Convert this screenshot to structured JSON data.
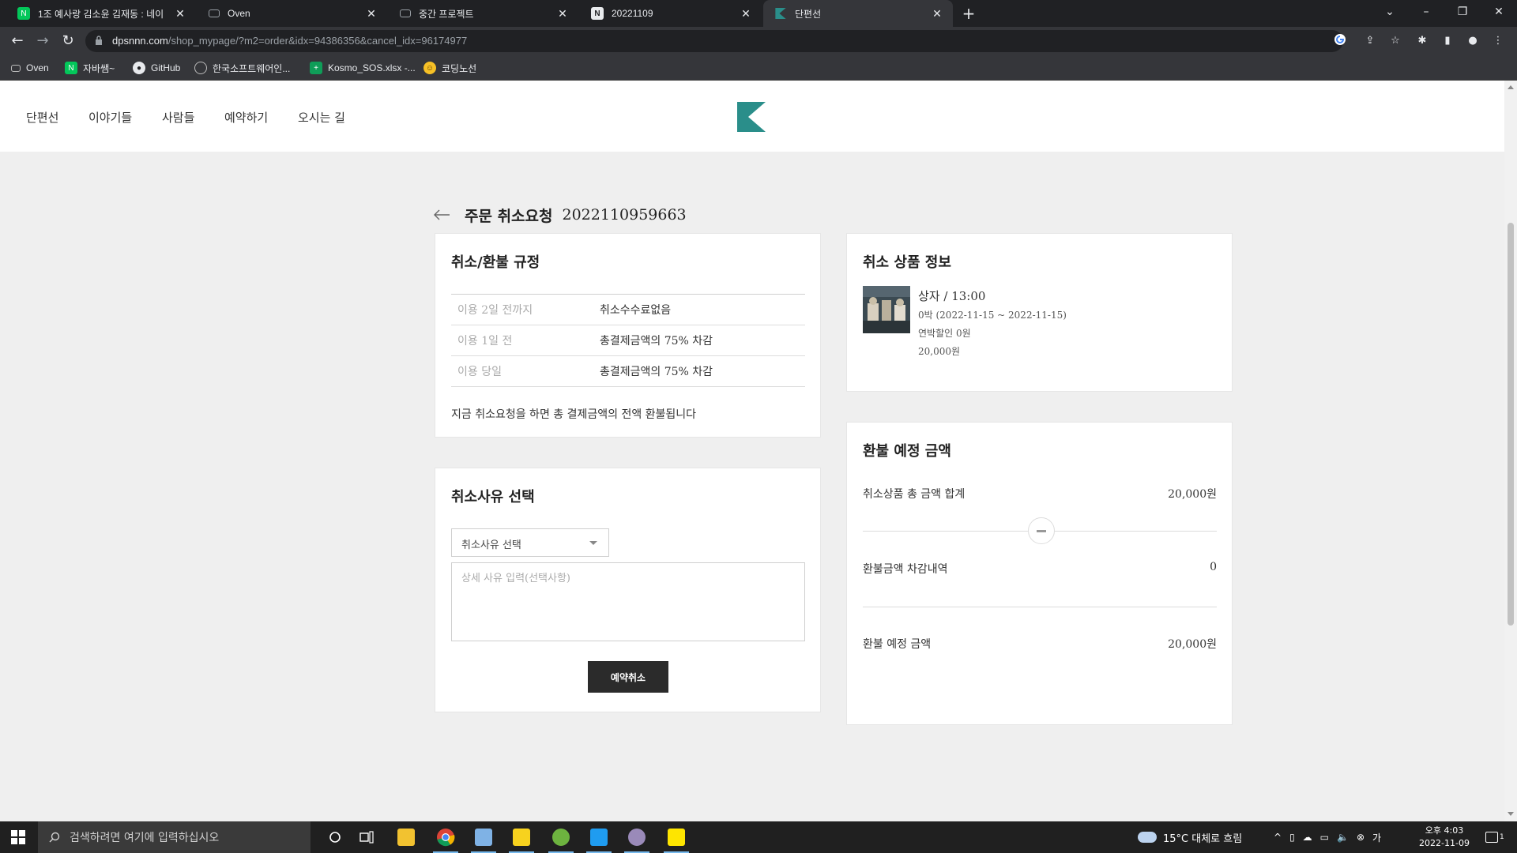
{
  "browser": {
    "tabs": [
      {
        "title": "1조 예사랑 김소윤 김재동 : 네이",
        "favicon_color": "#03c75a",
        "active": false
      },
      {
        "title": "Oven",
        "favicon_color": "#9aa0a6",
        "active": false
      },
      {
        "title": "중간 프로젝트",
        "favicon_color": "#9aa0a6",
        "active": false
      },
      {
        "title": "20221109",
        "favicon_color": "#e8eaed",
        "active": false
      },
      {
        "title": "단편선",
        "favicon_color": "#2a8e8a",
        "active": true
      }
    ],
    "url_host": "dpsnnn.com",
    "url_path": "/shop_mypage/?m2=order&idx=94386356&cancel_idx=96174977",
    "bookmarks": [
      {
        "label": "Oven",
        "icon": "monitor-icon"
      },
      {
        "label": "자바쌤~",
        "icon": "naver-icon"
      },
      {
        "label": "GitHub",
        "icon": "github-icon"
      },
      {
        "label": "한국소프트웨어인...",
        "icon": "globe-icon"
      },
      {
        "label": "Kosmo_SOS.xlsx -...",
        "icon": "sheets-icon"
      },
      {
        "label": "코딩노선",
        "icon": "emoji-icon"
      }
    ]
  },
  "site": {
    "nav": [
      "단편선",
      "이야기들",
      "사람들",
      "예약하기",
      "오시는 길"
    ],
    "brand_color": "#2a8e8a"
  },
  "order": {
    "title": "주문 취소요청",
    "number": "2022110959663"
  },
  "policy": {
    "title": "취소/환불 규정",
    "rows": [
      {
        "when": "이용 2일 전까지",
        "fee": "취소수수료없음"
      },
      {
        "when": "이용 1일 전",
        "fee": "총결제금액의 75% 차감"
      },
      {
        "when": "이용 당일",
        "fee": "총결제금액의 75% 차감"
      }
    ],
    "note": "지금 취소요청을 하면 총 결제금액의 전액 환불됩니다"
  },
  "reason": {
    "title": "취소사유 선택",
    "select_value": "취소사유 선택",
    "detail_placeholder": "상세 사유 입력(선택사항)",
    "submit_label": "예약취소"
  },
  "item": {
    "title": "취소 상품 정보",
    "name": "상자 / 13:00",
    "period": "0박 (2022-11-15 ~ 2022-11-15)",
    "discount": "연박할인 0원",
    "price": "20,000원"
  },
  "refund": {
    "title": "환불 예정 금액",
    "total_label": "취소상품 총 금액 합계",
    "total_value": "20,000원",
    "deduct_label": "환불금액 차감내역",
    "deduct_value": "0",
    "expected_label": "환불 예정 금액",
    "expected_value": "20,000원"
  },
  "taskbar": {
    "search_placeholder": "검색하려면 여기에 입력하십시오",
    "weather": "15°C  대체로 흐림",
    "time": "오후 4:03",
    "date": "2022-11-09",
    "notification_count": "1"
  }
}
